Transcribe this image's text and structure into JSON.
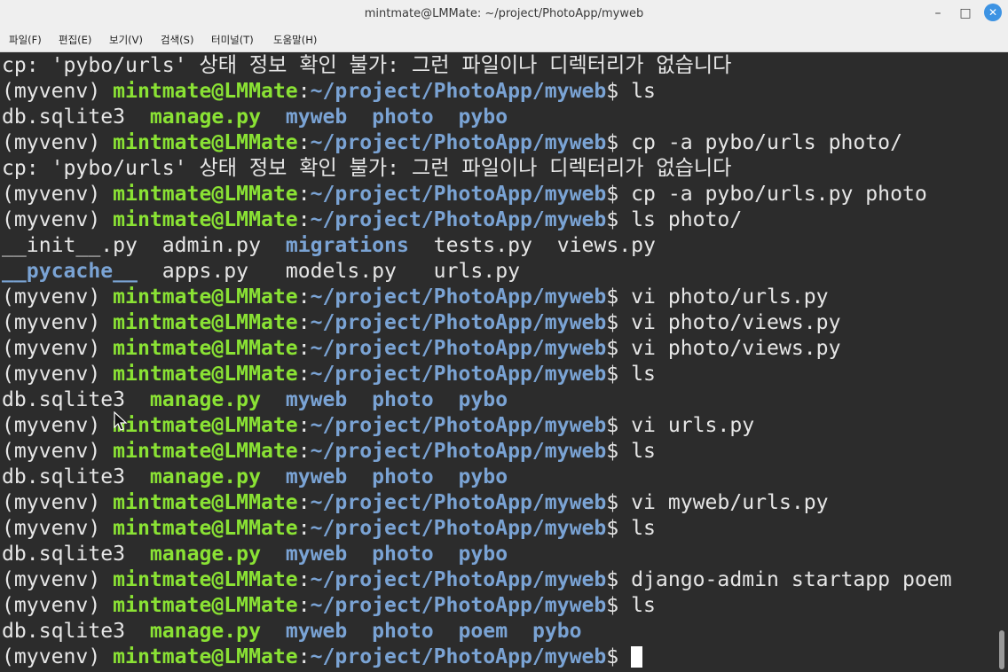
{
  "window": {
    "title": "mintmate@LMMate: ~/project/PhotoApp/myweb",
    "controls": {
      "minimize": "–",
      "maximize": "□",
      "close": "✕"
    }
  },
  "menu": [
    "파일(F)",
    "편집(E)",
    "보기(V)",
    "검색(S)",
    "터미널(T)",
    "도움말(H)"
  ],
  "terminal": {
    "prompt": {
      "venv": "(myvenv)",
      "user": "mintmate@LMMate",
      "sep": ":",
      "path": "~/project/PhotoApp/myweb",
      "dollar": "$"
    },
    "lines": [
      {
        "type": "text",
        "text": "cp: 'pybo/urls' 상태 정보 확인 불가: 그런 파일이나 디렉터리가 없습니다"
      },
      {
        "type": "prompt",
        "cmd": " ls"
      },
      {
        "type": "ls",
        "items": [
          {
            "t": "db.sqlite3",
            "c": "plain"
          },
          {
            "t": "manage.py",
            "c": "green"
          },
          {
            "t": "myweb",
            "c": "blue"
          },
          {
            "t": "photo",
            "c": "blue"
          },
          {
            "t": "pybo",
            "c": "blue"
          }
        ]
      },
      {
        "type": "prompt",
        "cmd": " cp -a pybo/urls photo/"
      },
      {
        "type": "text",
        "text": "cp: 'pybo/urls' 상태 정보 확인 불가: 그런 파일이나 디렉터리가 없습니다"
      },
      {
        "type": "prompt",
        "cmd": " cp -a pybo/urls.py photo"
      },
      {
        "type": "prompt",
        "cmd": " ls photo/"
      },
      {
        "type": "ls",
        "items": [
          {
            "t": "__init__.py",
            "c": "plain"
          },
          {
            "t": "admin.py",
            "c": "plain"
          },
          {
            "t": "migrations",
            "c": "blue"
          },
          {
            "t": "tests.py",
            "c": "plain"
          },
          {
            "t": "views.py",
            "c": "plain"
          }
        ]
      },
      {
        "type": "ls",
        "items": [
          {
            "t": "__pycache__",
            "c": "blue"
          },
          {
            "t": "apps.py",
            "c": "plain"
          },
          {
            "t": "models.py",
            "c": "plain"
          },
          {
            "t": "urls.py",
            "c": "plain"
          }
        ]
      },
      {
        "type": "prompt",
        "cmd": " vi photo/urls.py"
      },
      {
        "type": "prompt",
        "cmd": " vi photo/views.py"
      },
      {
        "type": "prompt",
        "cmd": " vi photo/views.py"
      },
      {
        "type": "prompt",
        "cmd": " ls"
      },
      {
        "type": "ls",
        "items": [
          {
            "t": "db.sqlite3",
            "c": "plain"
          },
          {
            "t": "manage.py",
            "c": "green"
          },
          {
            "t": "myweb",
            "c": "blue"
          },
          {
            "t": "photo",
            "c": "blue"
          },
          {
            "t": "pybo",
            "c": "blue"
          }
        ]
      },
      {
        "type": "prompt",
        "cmd": " vi urls.py"
      },
      {
        "type": "prompt",
        "cmd": " ls"
      },
      {
        "type": "ls",
        "items": [
          {
            "t": "db.sqlite3",
            "c": "plain"
          },
          {
            "t": "manage.py",
            "c": "green"
          },
          {
            "t": "myweb",
            "c": "blue"
          },
          {
            "t": "photo",
            "c": "blue"
          },
          {
            "t": "pybo",
            "c": "blue"
          }
        ]
      },
      {
        "type": "prompt",
        "cmd": " vi myweb/urls.py"
      },
      {
        "type": "prompt",
        "cmd": " ls"
      },
      {
        "type": "ls",
        "items": [
          {
            "t": "db.sqlite3",
            "c": "plain"
          },
          {
            "t": "manage.py",
            "c": "green"
          },
          {
            "t": "myweb",
            "c": "blue"
          },
          {
            "t": "photo",
            "c": "blue"
          },
          {
            "t": "pybo",
            "c": "blue"
          }
        ]
      },
      {
        "type": "prompt",
        "cmd": " django-admin startapp poem"
      },
      {
        "type": "prompt",
        "cmd": " ls"
      },
      {
        "type": "ls",
        "items": [
          {
            "t": "db.sqlite3",
            "c": "plain"
          },
          {
            "t": "manage.py",
            "c": "green"
          },
          {
            "t": "myweb",
            "c": "blue"
          },
          {
            "t": "photo",
            "c": "blue"
          },
          {
            "t": "poem",
            "c": "blue"
          },
          {
            "t": "pybo",
            "c": "blue"
          }
        ]
      },
      {
        "type": "prompt",
        "cmd": " ",
        "cursor": true
      }
    ]
  },
  "colors": {
    "title_bg": "#efefef",
    "terminal_bg": "#2c2c2c",
    "text": "#e6e6e6",
    "prompt_user": "#8ae234",
    "prompt_path": "#7aa3d4",
    "directory": "#7aa3d4",
    "executable": "#8ae234",
    "close_button": "#3d93e3"
  }
}
